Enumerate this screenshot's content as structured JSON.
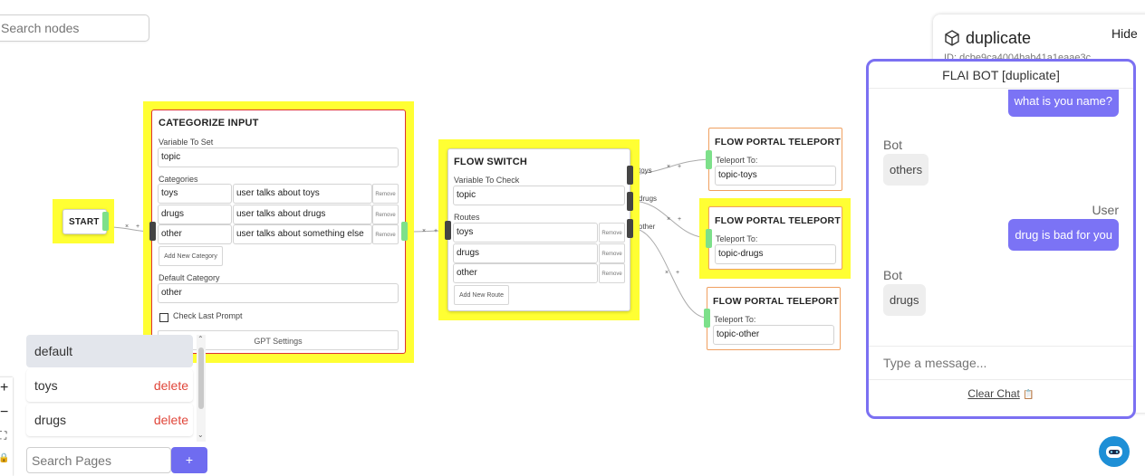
{
  "canvas": {
    "search_placeholder": "Search nodes"
  },
  "start_node": {
    "label": "START"
  },
  "categorize_node": {
    "title": "CATEGORIZE INPUT",
    "variable_label": "Variable To Set",
    "variable_value": "topic",
    "categories_label": "Categories",
    "categories": [
      {
        "name": "toys",
        "description": "user talks about toys",
        "remove": "Remove"
      },
      {
        "name": "drugs",
        "description": "user talks about drugs",
        "remove": "Remove"
      },
      {
        "name": "other",
        "description": "user talks about something else",
        "remove": "Remove"
      }
    ],
    "add_category": "Add New Category",
    "default_label": "Default Category",
    "default_value": "other",
    "check_last_prompt": "Check Last Prompt",
    "gpt_settings": "GPT Settings"
  },
  "switch_node": {
    "title": "FLOW SWITCH",
    "variable_label": "Variable To Check",
    "variable_value": "topic",
    "routes_label": "Routes",
    "routes": [
      {
        "value": "toys",
        "remove": "Remove"
      },
      {
        "value": "drugs",
        "remove": "Remove"
      },
      {
        "value": "other",
        "remove": "Remove"
      }
    ],
    "add_route": "Add New Route"
  },
  "edges": {
    "labels": [
      "toys",
      "drugs",
      "other"
    ],
    "remove_glyph": "×",
    "add_glyph": "+"
  },
  "portals": [
    {
      "title": "FLOW PORTAL TELEPORT",
      "label": "Teleport To:",
      "value": "topic-toys"
    },
    {
      "title": "FLOW PORTAL TELEPORT",
      "label": "Teleport To:",
      "value": "topic-drugs"
    },
    {
      "title": "FLOW PORTAL TELEPORT",
      "label": "Teleport To:",
      "value": "topic-other"
    }
  ],
  "pages_panel": {
    "items": [
      {
        "name": "default",
        "delete": ""
      },
      {
        "name": "toys",
        "delete": "delete"
      },
      {
        "name": "drugs",
        "delete": "delete"
      }
    ],
    "search_placeholder": "Search Pages",
    "add_label": "+"
  },
  "zoom_controls": {
    "zoom_in": "+",
    "zoom_out": "−",
    "fit": "⛶",
    "lock": "🔒"
  },
  "info_panel": {
    "title": "duplicate",
    "id_text": "ID: dcbe9ca4004bab41a1eaae3c",
    "hide_label": "Hide"
  },
  "chat": {
    "header": "FLAI BOT [duplicate]",
    "messages": [
      {
        "sender": "",
        "text": "what is you name?"
      },
      {
        "sender": "Bot",
        "text": "others"
      },
      {
        "sender": "User",
        "text": "drug is bad for you"
      },
      {
        "sender": "Bot",
        "text": "drugs"
      }
    ],
    "input_placeholder": "Type a message...",
    "clear_label": "Clear Chat"
  },
  "colors": {
    "highlight": "#ffff33",
    "chat_accent": "#7b70f2",
    "delete_red": "#e0463a",
    "handle_green": "#7de08a",
    "portal_border": "#f0a060"
  }
}
